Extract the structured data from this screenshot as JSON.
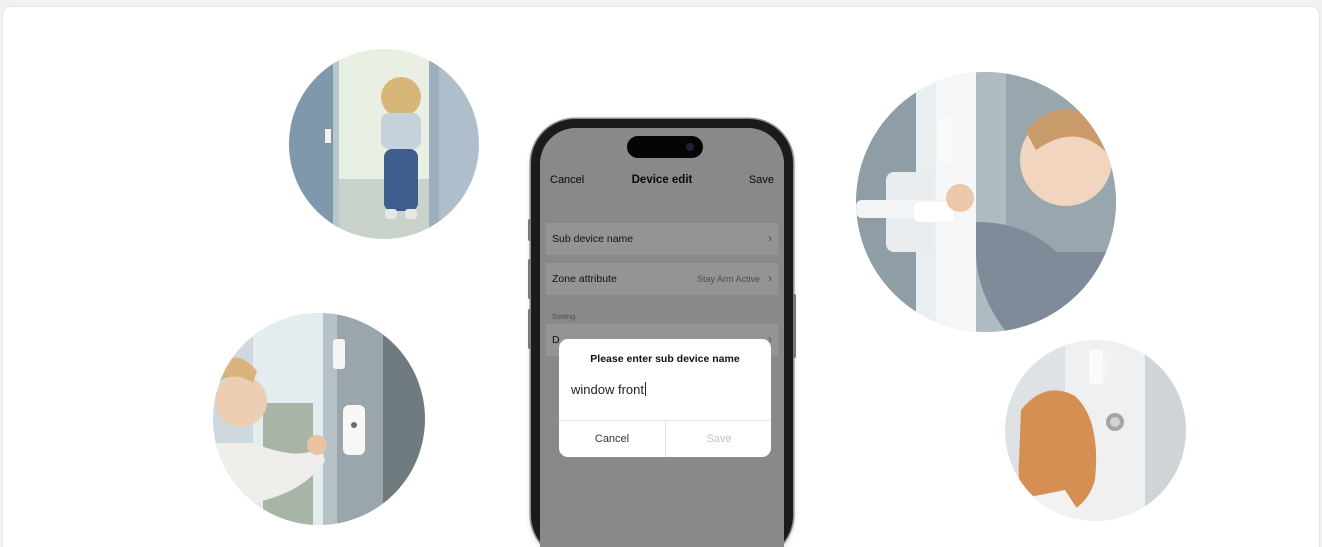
{
  "nav": {
    "cancel": "Cancel",
    "title": "Device edit",
    "save": "Save"
  },
  "rows": {
    "sub_device_name": {
      "label": "Sub device name"
    },
    "zone_attribute": {
      "label": "Zone attribute",
      "value": "Stay Arm Active"
    },
    "setting_section": "Setting",
    "setting_row": {
      "label": "D"
    }
  },
  "dialog": {
    "title": "Please enter sub device name",
    "input_value": "window front",
    "cancel": "Cancel",
    "save": "Save"
  },
  "icons": {
    "chevron": "chevron-right-icon"
  },
  "colors": {
    "overlay": "#000000",
    "dialog_bg": "#ffffff",
    "save_disabled": "#c3c3c3"
  }
}
